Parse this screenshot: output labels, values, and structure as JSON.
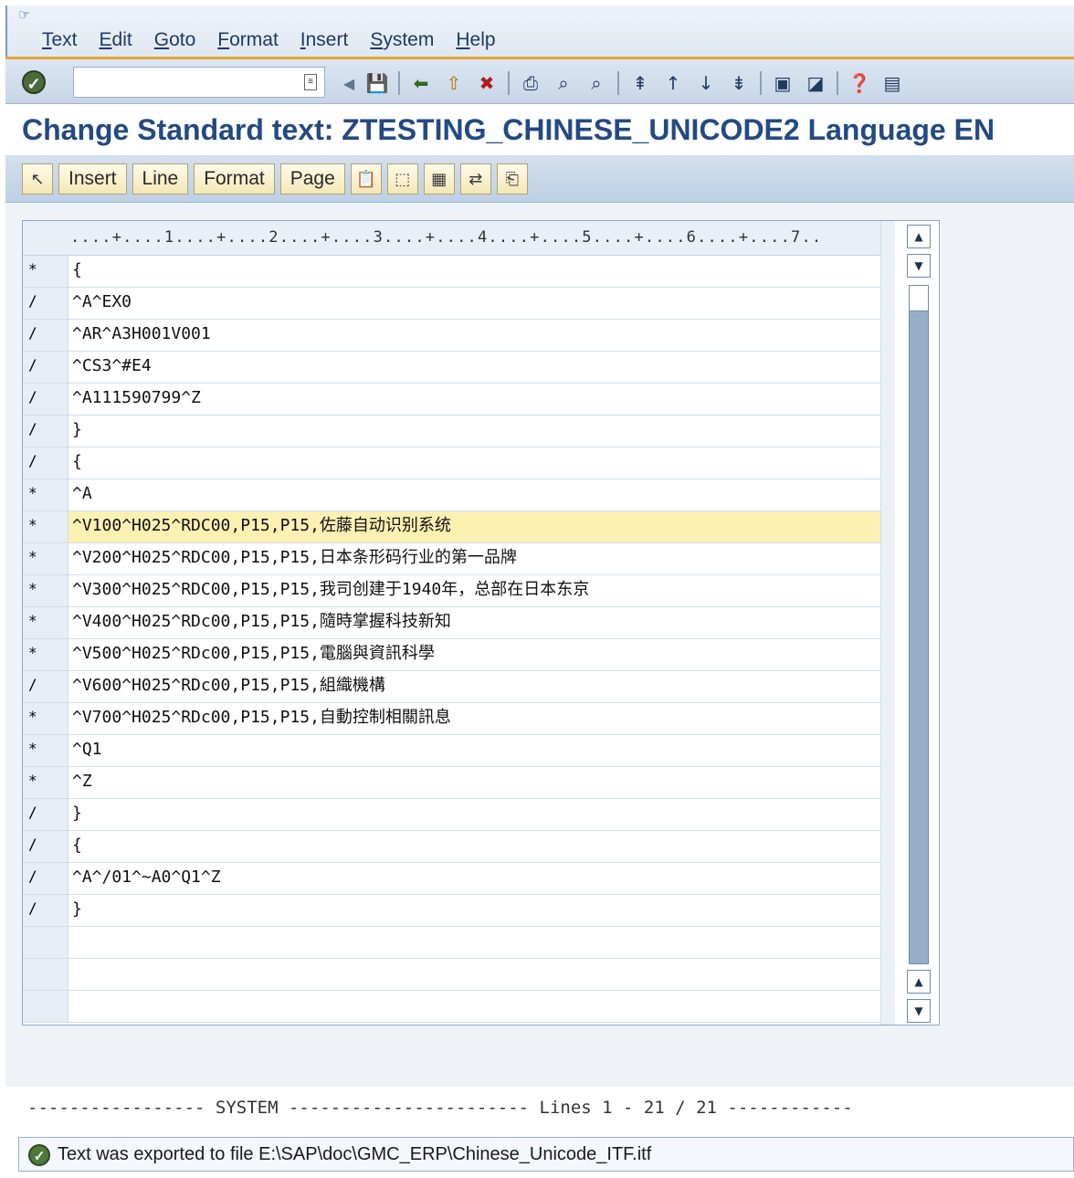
{
  "menu": {
    "items": [
      "Text",
      "Edit",
      "Goto",
      "Format",
      "Insert",
      "System",
      "Help"
    ]
  },
  "title": "Change Standard text: ZTESTING_CHINESE_UNICODE2 Language EN",
  "app_toolbar": {
    "buttons": [
      "Insert",
      "Line",
      "Format",
      "Page"
    ]
  },
  "editor": {
    "ruler": "....+....1....+....2....+....3....+....4....+....5....+....6....+....7..",
    "rows": [
      {
        "fmt": "*",
        "text": "{"
      },
      {
        "fmt": "/",
        "text": "^A^EX0"
      },
      {
        "fmt": "/",
        "text": "^AR^A3H001V001"
      },
      {
        "fmt": "/",
        "text": "^CS3^#E4"
      },
      {
        "fmt": "/",
        "text": "^A111590799^Z"
      },
      {
        "fmt": "/",
        "text": "}"
      },
      {
        "fmt": "/",
        "text": "{"
      },
      {
        "fmt": "*",
        "text": "^A"
      },
      {
        "fmt": "*",
        "text": "^V100^H025^RDC00,P15,P15,佐藤自动识别系统"
      },
      {
        "fmt": "*",
        "text": "^V200^H025^RDC00,P15,P15,日本条形码行业的第一品牌"
      },
      {
        "fmt": "*",
        "text": "^V300^H025^RDC00,P15,P15,我司创建于1940年，总部在日本东京"
      },
      {
        "fmt": "*",
        "text": "^V400^H025^RDc00,P15,P15,隨時掌握科技新知"
      },
      {
        "fmt": "*",
        "text": "^V500^H025^RDc00,P15,P15,電腦與資訊科學"
      },
      {
        "fmt": "/",
        "text": "^V600^H025^RDc00,P15,P15,組織機構"
      },
      {
        "fmt": "*",
        "text": "^V700^H025^RDc00,P15,P15,自動控制相關訊息"
      },
      {
        "fmt": "*",
        "text": "^Q1"
      },
      {
        "fmt": "*",
        "text": "^Z"
      },
      {
        "fmt": "/",
        "text": "}"
      },
      {
        "fmt": "/",
        "text": "{"
      },
      {
        "fmt": "/",
        "text": "^A^/01^~A0^Q1^Z"
      },
      {
        "fmt": "/",
        "text": "}"
      },
      {
        "fmt": "",
        "text": ""
      },
      {
        "fmt": "",
        "text": ""
      },
      {
        "fmt": "",
        "text": ""
      }
    ],
    "highlight_row": 8
  },
  "status_line": "----------------- SYSTEM ----------------------- Lines 1 - 21 / 21 ------------",
  "message": "Text was exported to file E:\\SAP\\doc\\GMC_ERP\\Chinese_Unicode_ITF.itf",
  "colors": {
    "title": "#234a82",
    "highlight": "#fdf0b3",
    "accent_stripe": "#e4a632"
  }
}
